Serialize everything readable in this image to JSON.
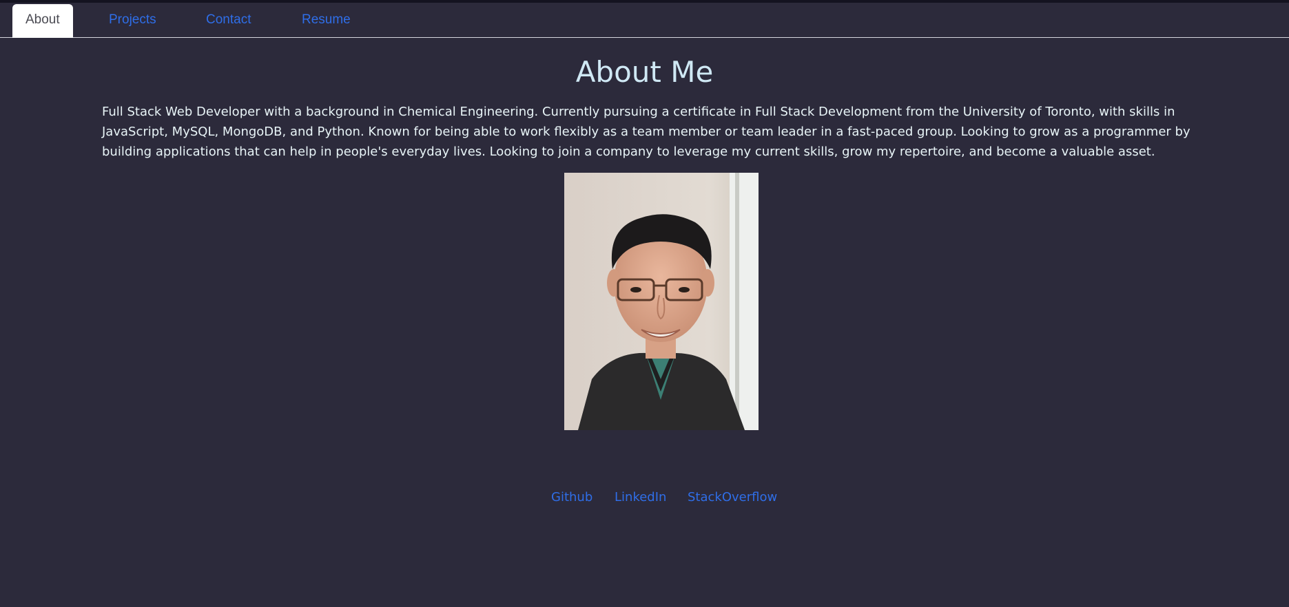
{
  "nav": {
    "tabs": [
      {
        "label": "About",
        "active": true
      },
      {
        "label": "Projects",
        "active": false
      },
      {
        "label": "Contact",
        "active": false
      },
      {
        "label": "Resume",
        "active": false
      }
    ]
  },
  "main": {
    "title": "About Me",
    "bio": "Full Stack Web Developer with a background in Chemical Engineering. Currently pursuing a certificate in Full Stack Development from the University of Toronto, with skills in JavaScript, MySQL, MongoDB, and Python. Known for being able to work flexibly as a team member or team leader in a fast-paced group. Looking to grow as a programmer by building applications that can help in people's everyday lives. Looking to join a company to leverage my current skills, grow my repertoire, and become a valuable asset."
  },
  "social": {
    "github": "Github",
    "linkedin": "LinkedIn",
    "stackoverflow": "StackOverflow"
  },
  "colors": {
    "background": "#2c2a3b",
    "link": "#2f6ee8",
    "heading": "#cfe8f4",
    "text": "#e8f4f7"
  }
}
